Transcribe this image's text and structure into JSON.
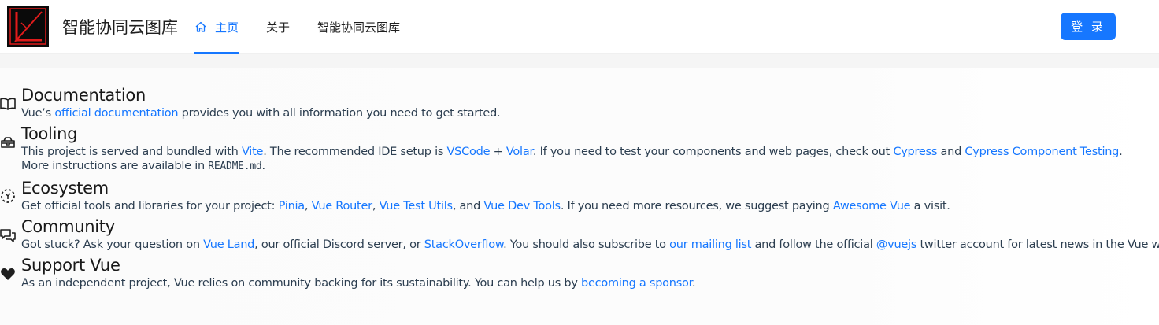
{
  "header": {
    "site_title": "智能协同云图库",
    "nav": [
      {
        "label": "主页",
        "icon": "home-icon",
        "active": true
      },
      {
        "label": "关于"
      },
      {
        "label": "智能协同云图库"
      }
    ],
    "login_label": "登 录",
    "accent_color": "#1677ff"
  },
  "sections": [
    {
      "icon": "documentation-icon",
      "title": "Documentation",
      "parts": {
        "t1": "Vue’s ",
        "l1": "official documentation",
        "t2": " provides you with all information you need to get started."
      }
    },
    {
      "icon": "tooling-icon",
      "title": "Tooling",
      "parts": {
        "t1": "This project is served and bundled with ",
        "l1": "Vite",
        "t2": ". The recommended IDE setup is ",
        "l2": "VSCode",
        "t3": " + ",
        "l3": "Volar",
        "t4": ". If you need to test your components and web pages, check out ",
        "l4": "Cypress",
        "t5": " and ",
        "l5": "Cypress Component Testing",
        "t6": ".",
        "t7": "More instructions are available in ",
        "code": "README.md",
        "t8": "."
      }
    },
    {
      "icon": "ecosystem-icon",
      "title": "Ecosystem",
      "parts": {
        "t1": "Get official tools and libraries for your project: ",
        "l1": "Pinia",
        "t2": ", ",
        "l2": "Vue Router",
        "t3": ", ",
        "l3": "Vue Test Utils",
        "t4": ", and ",
        "l4": "Vue Dev Tools",
        "t5": ". If you need more resources, we suggest paying ",
        "l5": "Awesome Vue",
        "t6": " a visit."
      }
    },
    {
      "icon": "community-icon",
      "title": "Community",
      "parts": {
        "t1": "Got stuck? Ask your question on ",
        "l1": "Vue Land",
        "t2": ", our official Discord server, or ",
        "l2": "StackOverflow",
        "t3": ". You should also subscribe to ",
        "l3": "our mailing list",
        "t4": " and follow the official ",
        "l4": "@vuejs",
        "t5": " twitter account for latest news in the Vue world."
      }
    },
    {
      "icon": "support-heart-icon",
      "title": "Support Vue",
      "parts": {
        "t1": "As an independent project, Vue relies on community backing for its sustainability. You can help us by ",
        "l1": "becoming a sponsor",
        "t2": "."
      }
    }
  ]
}
